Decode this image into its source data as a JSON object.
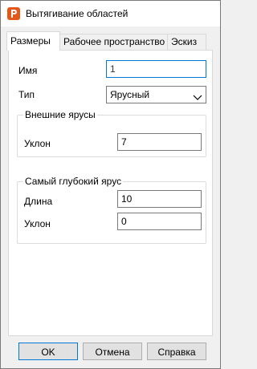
{
  "window": {
    "title": "Вытягивание областей",
    "icon": "app-logo-icon"
  },
  "tabs": [
    {
      "label": "Размеры",
      "active": true
    },
    {
      "label": "Рабочее пространство",
      "active": false
    },
    {
      "label": "Эскиз",
      "active": false
    }
  ],
  "form": {
    "name_label": "Имя",
    "name_value": "1",
    "type_label": "Тип",
    "type_value": "Ярусный"
  },
  "outer_tiers": {
    "title": "Внешние ярусы",
    "slope_label": "Уклон",
    "slope_value": "7"
  },
  "deepest_tier": {
    "title": "Самый глубокий ярус",
    "length_label": "Длина",
    "length_value": "10",
    "slope_label": "Уклон",
    "slope_value": "0"
  },
  "buttons": {
    "ok": "OK",
    "cancel": "Отмена",
    "help": "Справка"
  },
  "colors": {
    "accent": "#0078d7",
    "app_icon": "#e4571b"
  }
}
